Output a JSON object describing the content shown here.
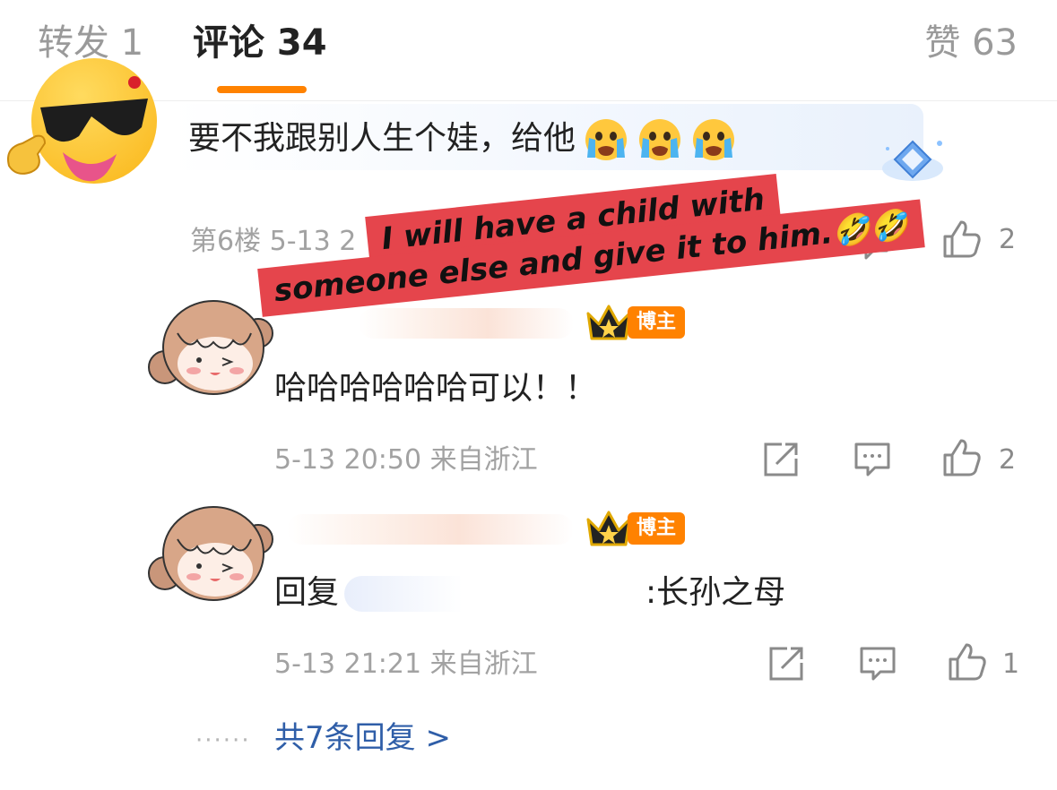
{
  "tabs": {
    "repost": "转发 1",
    "comments": "评论 34",
    "likes": "赞 63"
  },
  "main_comment": {
    "text": "要不我跟别人生个娃，给他",
    "meta": "第6楼 5-13 2",
    "like_count": "2",
    "caption_line1": "I will have a child with",
    "caption_line2": "someone else and give it to him.🤣🤣"
  },
  "replies": [
    {
      "author_tag": "博主",
      "text": "哈哈哈哈哈哈可以！！",
      "meta": "5-13 20:50 来自浙江",
      "like_count": "2"
    },
    {
      "author_tag": "博主",
      "text_prefix": "回复",
      "text_suffix": ":长孙之母",
      "meta": "5-13 21:21 来自浙江",
      "like_count": "1"
    }
  ],
  "more_replies": "共7条回复 >",
  "colors": {
    "accent": "#ff8200",
    "link": "#2f5ea8",
    "caption_bg": "#e5454c"
  },
  "icons": [
    "sunglasses-emoji-icon",
    "crying-emoji-icon",
    "diamond-badge-icon",
    "share-icon",
    "comment-icon",
    "thumbs-up-icon",
    "crown-icon"
  ]
}
